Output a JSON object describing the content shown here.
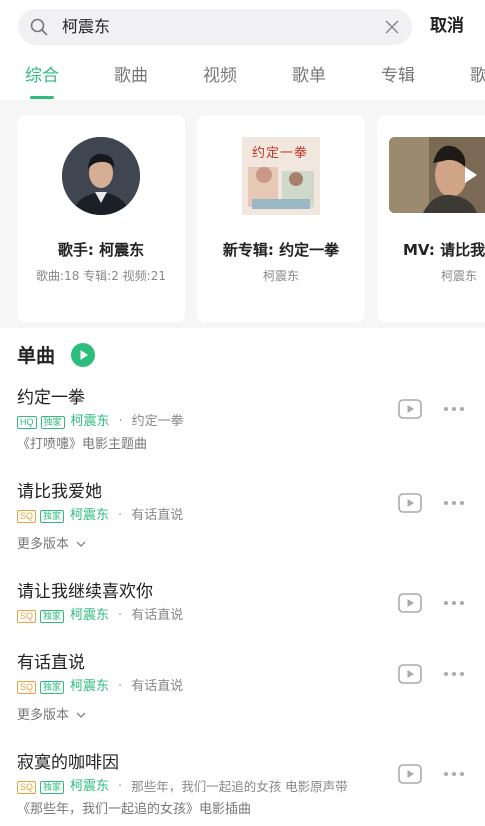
{
  "search": {
    "query": "柯震东",
    "cancel_label": "取消"
  },
  "tabs": [
    {
      "label": "综合",
      "active": true
    },
    {
      "label": "歌曲"
    },
    {
      "label": "视频"
    },
    {
      "label": "歌单"
    },
    {
      "label": "专辑"
    },
    {
      "label": "歌"
    }
  ],
  "cards": [
    {
      "title": "歌手: 柯震东",
      "subtitle": "歌曲:18 专辑:2 视频:21"
    },
    {
      "title": "新专辑: 约定一拳",
      "subtitle": "柯震东",
      "cover_text": "约定一拳"
    },
    {
      "title": "MV: 请比我",
      "subtitle": "柯震东"
    }
  ],
  "section": {
    "title": "单曲"
  },
  "songs": [
    {
      "title": "约定一拳",
      "badges": [
        "HQ",
        "独家"
      ],
      "artist": "柯震东",
      "album": "约定一拳",
      "description": "《打喷嚏》电影主题曲"
    },
    {
      "title": "请比我爱她",
      "badges": [
        "SQ",
        "独家"
      ],
      "artist": "柯震东",
      "album": "有话直说",
      "more": "更多版本"
    },
    {
      "title": "请让我继续喜欢你",
      "badges": [
        "SQ",
        "独家"
      ],
      "artist": "柯震东",
      "album": "有话直说"
    },
    {
      "title": "有话直说",
      "badges": [
        "SQ",
        "独家"
      ],
      "artist": "柯震东",
      "album": "有话直说",
      "more": "更多版本"
    },
    {
      "title": "寂寞的咖啡因",
      "badges": [
        "SQ",
        "独家"
      ],
      "artist": "柯震东",
      "album": "那些年，我们一起追的女孩 电影原声带",
      "description": "《那些年，我们一起追的女孩》电影插曲"
    }
  ],
  "colors": {
    "accent": "#2fbd7e",
    "sq_badge": "#e8a33a",
    "background_band": "#f6f6f6"
  }
}
